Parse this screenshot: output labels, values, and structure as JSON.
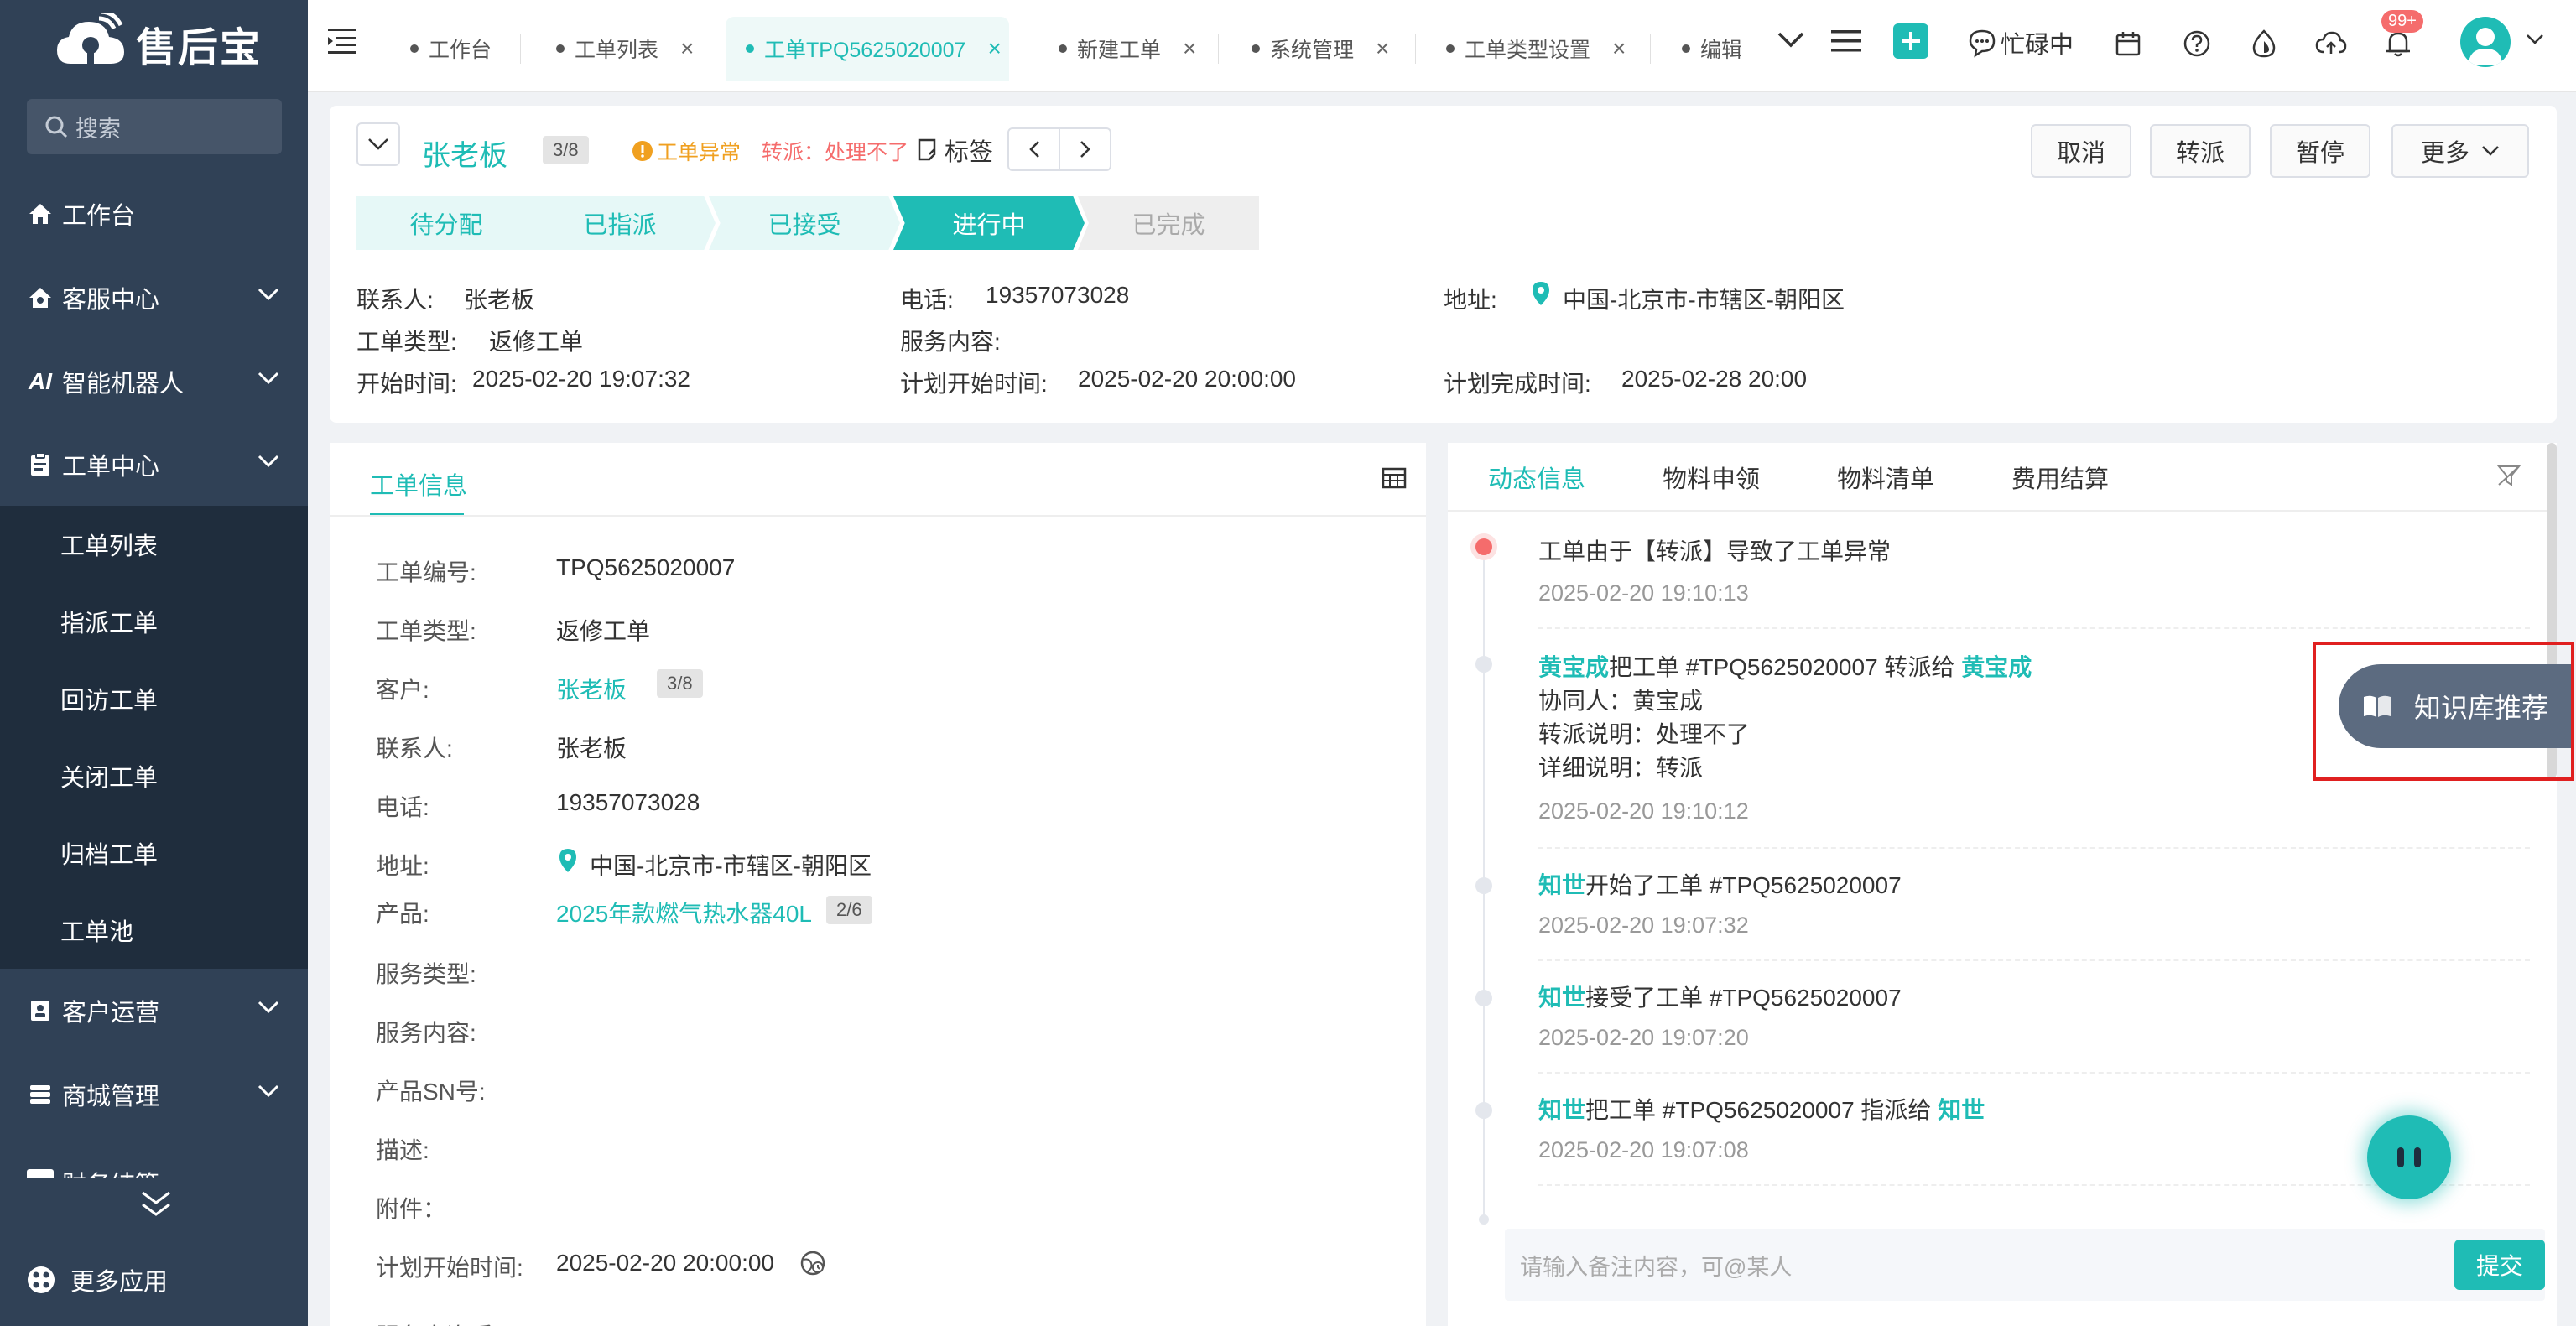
{
  "app": {
    "logo_text": "售后宝",
    "search_placeholder": "搜索"
  },
  "sidebar": {
    "items": [
      {
        "label": "工作台",
        "icon": "home-icon"
      },
      {
        "label": "客服中心",
        "icon": "service-icon"
      },
      {
        "label": "智能机器人",
        "icon": "ai-icon"
      },
      {
        "label": "工单中心",
        "icon": "workorder-icon"
      },
      {
        "label": "客户运营",
        "icon": "customer-icon"
      },
      {
        "label": "商城管理",
        "icon": "mall-icon"
      },
      {
        "label": "财务结算",
        "icon": "finance-icon"
      }
    ],
    "sub_items": [
      "工单列表",
      "指派工单",
      "回访工单",
      "关闭工单",
      "归档工单",
      "工单池"
    ],
    "more_apps": "更多应用"
  },
  "topbar": {
    "tabs": [
      {
        "label": "工作台",
        "closable": false
      },
      {
        "label": "工单列表",
        "closable": true
      },
      {
        "label": "工单TPQ5625020007",
        "closable": true,
        "active": true
      },
      {
        "label": "新建工单",
        "closable": true
      },
      {
        "label": "系统管理",
        "closable": true
      },
      {
        "label": "工单类型设置",
        "closable": true
      },
      {
        "label": "编辑",
        "closable": false
      }
    ],
    "status": "忙碌中",
    "notification_count": "99+"
  },
  "header": {
    "customer_name": "张老板",
    "customer_tag": "3/8",
    "exception_label": "工单异常",
    "transfer_label": "转派：处理不了",
    "tag_label": "标签",
    "buttons": [
      "取消",
      "转派",
      "暂停",
      "更多"
    ],
    "steps": [
      "待分配",
      "已指派",
      "已接受",
      "进行中",
      "已完成"
    ],
    "active_step": 3,
    "contact_label": "联系人:",
    "contact_value": "张老板",
    "phone_label": "电话:",
    "phone_value": "19357073028",
    "address_label": "地址:",
    "address_value": "中国-北京市-市辖区-朝阳区",
    "type_label": "工单类型:",
    "type_value": "返修工单",
    "service_content_label": "服务内容:",
    "start_label": "开始时间:",
    "start_value": "2025-02-20 19:07:32",
    "plan_start_label": "计划开始时间:",
    "plan_start_value": "2025-02-20 20:00:00",
    "plan_end_label": "计划完成时间:",
    "plan_end_value": "2025-02-28 20:00"
  },
  "left_panel": {
    "tab": "工单信息",
    "fields": [
      {
        "label": "工单编号:",
        "value": "TPQ5625020007"
      },
      {
        "label": "工单类型:",
        "value": "返修工单"
      },
      {
        "label": "客户:",
        "value": "张老板",
        "tag": "3/8"
      },
      {
        "label": "联系人:",
        "value": "张老板"
      },
      {
        "label": "电话:",
        "value": "19357073028"
      },
      {
        "label": "地址:",
        "value": "中国-北京市-市辖区-朝阳区"
      },
      {
        "label": "产品:",
        "value": "2025年款燃气热水器40L",
        "tag": "2/6"
      },
      {
        "label": "服务类型:",
        "value": ""
      },
      {
        "label": "服务内容:",
        "value": ""
      },
      {
        "label": "产品SN号:",
        "value": ""
      },
      {
        "label": "描述:",
        "value": ""
      },
      {
        "label": "附件：",
        "value": ""
      },
      {
        "label": "计划开始时间:",
        "value": "2025-02-20 20:00:00"
      },
      {
        "label": "服务商资质:",
        "value": ""
      }
    ]
  },
  "right_panel": {
    "tabs": [
      "动态信息",
      "物料申领",
      "物料清单",
      "费用结算"
    ],
    "timeline": [
      {
        "pre": "",
        "text": "工单由于【转派】导致了工单异常",
        "time": "2025-02-20 19:10:13"
      },
      {
        "actor": "黄宝成",
        "text": "把工单 #TPQ5625020007 转派给 ",
        "target": "黄宝成",
        "details": [
          "协同人：黄宝成",
          "转派说明：处理不了",
          "详细说明：转派"
        ],
        "time": "2025-02-20 19:10:12"
      },
      {
        "actor": "知世",
        "text": "开始了工单 #TPQ5625020007",
        "time": "2025-02-20 19:07:32"
      },
      {
        "actor": "知世",
        "text": "接受了工单 #TPQ5625020007",
        "time": "2025-02-20 19:07:20"
      },
      {
        "actor": "知世",
        "text": "把工单 #TPQ5625020007 指派给 ",
        "target": "知世",
        "time": "2025-02-20 19:07:08"
      }
    ],
    "kb_button": "知识库推荐",
    "comment_placeholder": "请输入备注内容，可@某人",
    "submit": "提交"
  },
  "colors": {
    "accent": "#1fbcb5",
    "sidebar_bg": "#304156",
    "danger": "#f56c6c",
    "warning": "#f0a020"
  }
}
